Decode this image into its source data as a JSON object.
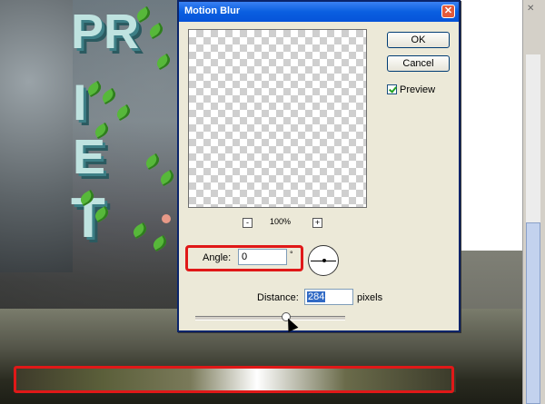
{
  "dialog": {
    "title": "Motion Blur",
    "close_symbol": "✕",
    "ok_label": "OK",
    "cancel_label": "Cancel",
    "preview_label": "Preview",
    "preview_checked": true,
    "zoom_minus": "-",
    "zoom_plus": "+",
    "zoom_level": "100%",
    "angle_label": "Angle:",
    "angle_value": "0",
    "degree_symbol": "°",
    "distance_label": "Distance:",
    "distance_value": "284",
    "pixels_label": "pixels",
    "distance_slider_level": 0.57
  },
  "background": {
    "artwork_letters": [
      "PR",
      "I",
      "E",
      "T"
    ],
    "highlight_color": "#e01818"
  },
  "icons": {
    "close": "close-icon",
    "checkbox": "checkmark-icon",
    "angle_dial": "angle-dial-icon",
    "cursor": "mouse-pointer-icon"
  }
}
